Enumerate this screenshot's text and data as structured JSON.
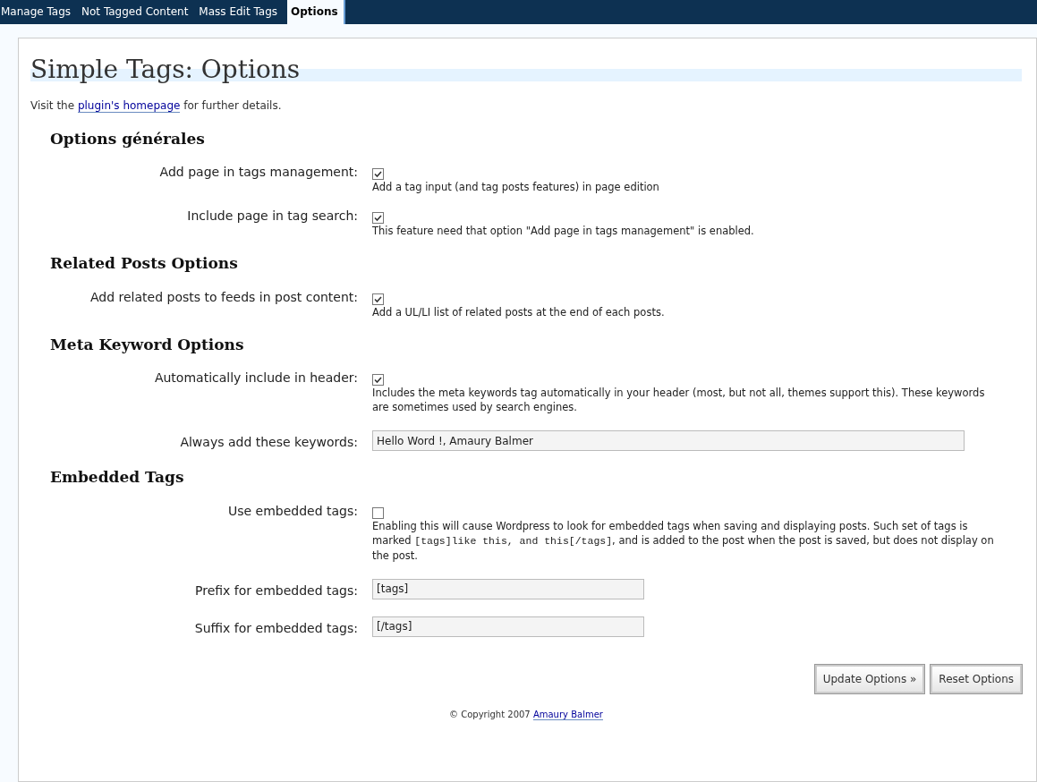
{
  "tabs": [
    {
      "label": "Manage Tags",
      "selected": false
    },
    {
      "label": "Not Tagged Content",
      "selected": false
    },
    {
      "label": "Mass Edit Tags",
      "selected": false
    },
    {
      "label": "Options",
      "selected": true
    }
  ],
  "title": "Simple Tags: Options",
  "intro": {
    "before": "Visit the",
    "link": "plugin's homepage",
    "after": "for further details."
  },
  "sections": [
    {
      "heading": "Options générales",
      "rows": [
        {
          "kind": "checkbox",
          "label": "Add page in tags management:",
          "checked": true,
          "description": [
            {
              "text": "Add a tag input (and tag posts features) in page edition",
              "code": false
            }
          ]
        },
        {
          "kind": "checkbox",
          "label": "Include page in tag search:",
          "checked": true,
          "description": [
            {
              "text": "This feature need that option \"Add page in tags management\" is enabled.",
              "code": false
            }
          ]
        }
      ]
    },
    {
      "heading": "Related Posts Options",
      "rows": [
        {
          "kind": "checkbox",
          "label": "Add related posts to feeds in post content:",
          "checked": true,
          "description": [
            {
              "text": "Add a UL/LI list of related posts at the end of each posts.",
              "code": false
            }
          ]
        }
      ]
    },
    {
      "heading": "Meta Keyword Options",
      "rows": [
        {
          "kind": "checkbox",
          "label": "Automatically include in header:",
          "checked": true,
          "description": [
            {
              "text": "Includes the meta keywords tag automatically in your header (most, but not all, themes support this). These keywords are sometimes used by search engines.",
              "code": false
            }
          ]
        },
        {
          "kind": "widefield",
          "label": "Always add these keywords:",
          "value": "Hello Word !, Amaury Balmer"
        }
      ]
    },
    {
      "heading": "Embedded Tags",
      "rows": [
        {
          "kind": "checkbox",
          "label": "Use embedded tags:",
          "checked": false,
          "description": [
            {
              "text": "Enabling this will cause Wordpress to look for embedded tags when saving and displaying posts. Such set of tags is marked ",
              "code": false
            },
            {
              "text": "[tags]like this, and this[/tags]",
              "code": true
            },
            {
              "text": ", and is added to the post when the post is saved, but does not display on the post.",
              "code": false
            }
          ]
        },
        {
          "kind": "shortfield",
          "label": "Prefix for embedded tags:",
          "value": "[tags]"
        },
        {
          "kind": "shortfield",
          "label": "Suffix for embedded tags:",
          "value": "[/tags]"
        }
      ]
    }
  ],
  "buttons": [
    "Update Options »",
    "Reset Options"
  ],
  "footer": {
    "text": "© Copyright 2007",
    "link": "Amaury Balmer"
  }
}
